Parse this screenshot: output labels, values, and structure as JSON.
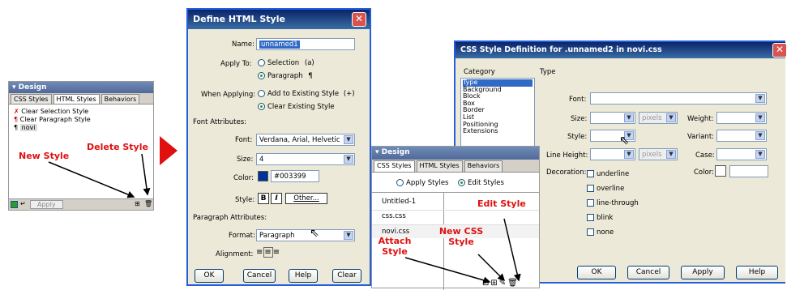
{
  "left_panel": {
    "title": "Design",
    "tabs": [
      "CSS Styles",
      "HTML Styles",
      "Behaviors"
    ],
    "items": [
      "Clear Selection Style",
      "Clear Paragraph Style",
      "novi"
    ],
    "apply_label": "Apply",
    "annotation_new": "New Style",
    "annotation_delete": "Delete Style"
  },
  "define_dialog": {
    "title": "Define HTML Style",
    "name_label": "Name:",
    "name_value": "unnamed1",
    "apply_to_label": "Apply To:",
    "apply_selection": "Selection",
    "apply_selection_icon": "(a)",
    "apply_paragraph": "Paragraph",
    "apply_paragraph_icon": "¶",
    "when_applying_label": "When Applying:",
    "add_existing": "Add to Existing Style",
    "add_existing_icon": "(+)",
    "clear_existing": "Clear Existing Style",
    "font_attributes": "Font Attributes:",
    "font_label": "Font:",
    "font_value": "Verdana, Arial, Helvetic",
    "size_label": "Size:",
    "size_value": "4",
    "color_label": "Color:",
    "color_value": "#003399",
    "style_label": "Style:",
    "bold": "B",
    "italic": "I",
    "other": "Other...",
    "paragraph_attributes": "Paragraph Attributes:",
    "format_label": "Format:",
    "format_value": "Paragraph",
    "alignment_label": "Alignment:",
    "ok": "OK",
    "cancel": "Cancel",
    "help": "Help",
    "clear": "Clear"
  },
  "css_def_dialog": {
    "title": "CSS Style Definition for .unnamed2 in novi.css",
    "category_label": "Category",
    "type_label": "Type",
    "categories": [
      "Type",
      "Background",
      "Block",
      "Box",
      "Border",
      "List",
      "Positioning",
      "Extensions"
    ],
    "font_label": "Font:",
    "size_label": "Size:",
    "pixels": "pixels",
    "weight_label": "Weight:",
    "style_label": "Style:",
    "variant_label": "Variant:",
    "line_height_label": "Line Height:",
    "case_label": "Case:",
    "decoration_label": "Decoration:",
    "decorations": [
      "underline",
      "overline",
      "line-through",
      "blink",
      "none"
    ],
    "color_label": "Color:",
    "ok": "OK",
    "cancel": "Cancel",
    "apply": "Apply",
    "help": "Help"
  },
  "design_panel2": {
    "title": "Design",
    "tabs": [
      "CSS Styles",
      "HTML Styles",
      "Behaviors"
    ],
    "apply_styles": "Apply Styles",
    "edit_styles": "Edit Styles",
    "files": [
      "Untitled-1",
      "css.css",
      "novi.css"
    ],
    "annotation_edit": "Edit Style",
    "annotation_new_css": "New CSS Style",
    "annotation_attach": "Attach Style"
  }
}
